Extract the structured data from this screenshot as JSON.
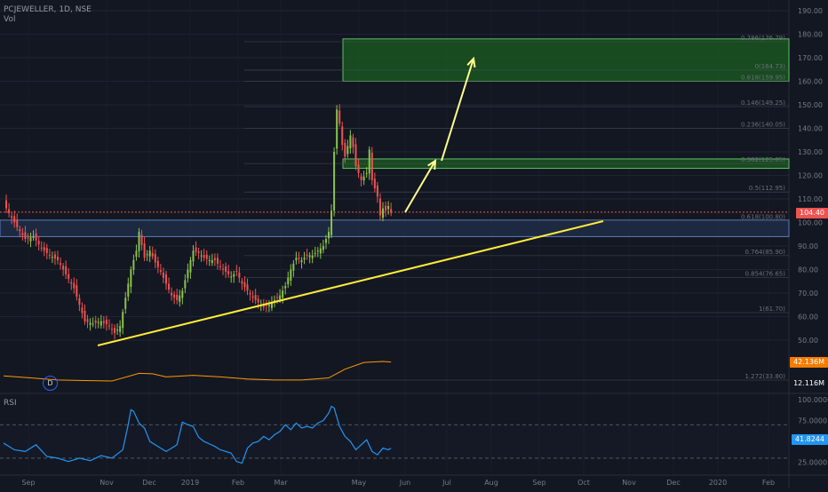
{
  "header": {
    "symbol": "PCJEWELLER, 1D, NSE",
    "vol_label": "Vol",
    "rsi_label": "RSI"
  },
  "colors": {
    "background": "#131722",
    "up": "#26a69a",
    "up_body": "#8bc34a",
    "down": "#ef5350",
    "trendline": "#ffeb3b",
    "arrow": "#ffff8d",
    "rsi": "#2196f3",
    "volume_ma": "#ff9800",
    "zone_green": "#1b5e20",
    "zone_blue": "#1e2b45",
    "price_line": "#ef5350"
  },
  "badges": {
    "price": "104.40",
    "volume_ma": "42.136M",
    "volume": "12.116M",
    "rsi": "41.8244"
  },
  "dividend_marker": "D",
  "chart_data": {
    "type": "candlestick",
    "title": "PCJEWELLER, 1D, NSE",
    "price_axis": {
      "ylim": [
        50,
        190
      ],
      "ticks": [
        "190.00",
        "180.00",
        "170.00",
        "160.00",
        "150.00",
        "140.00",
        "130.00",
        "120.00",
        "110.00",
        "100.00",
        "90.00",
        "80.00",
        "70.00",
        "60.00",
        "50.00"
      ]
    },
    "x_axis": {
      "labels": [
        "Sep",
        "Nov",
        "Dec",
        "2019",
        "Feb",
        "Mar",
        "May",
        "Jun",
        "Jul",
        "Aug",
        "Sep",
        "Oct",
        "Nov",
        "Dec",
        "2020",
        "Feb"
      ]
    },
    "fib_levels": [
      {
        "label": "0.786(176.79)",
        "value": 176.79
      },
      {
        "label": "0(164.73)",
        "value": 164.73
      },
      {
        "label": "0.618(159.95)",
        "value": 159.95
      },
      {
        "label": "0.146(149.25)",
        "value": 149.25
      },
      {
        "label": "0.236(140.05)",
        "value": 140.05
      },
      {
        "label": "0.382(125.05)",
        "value": 125.05
      },
      {
        "label": "0.5(112.95)",
        "value": 112.95
      },
      {
        "label": "0.618(100.80)",
        "value": 100.8
      },
      {
        "label": "0.764(85.90)",
        "value": 85.9
      },
      {
        "label": "0.854(76.65)",
        "value": 76.65
      },
      {
        "label": "1(61.70)",
        "value": 61.7
      },
      {
        "label": "1.272(33.80)",
        "value": 33.8
      }
    ],
    "zones": [
      {
        "kind": "green",
        "top": 178,
        "bottom": 160
      },
      {
        "kind": "green",
        "top": 127,
        "bottom": 123
      },
      {
        "kind": "blue",
        "top": 101,
        "bottom": 94
      }
    ],
    "last_price": 104.4,
    "price_path": [
      [
        0,
        108
      ],
      [
        2,
        104
      ],
      [
        5,
        98
      ],
      [
        8,
        93
      ],
      [
        11,
        94
      ],
      [
        14,
        89
      ],
      [
        17,
        86
      ],
      [
        20,
        84
      ],
      [
        23,
        78
      ],
      [
        26,
        72
      ],
      [
        28,
        65
      ],
      [
        30,
        58
      ],
      [
        33,
        57
      ],
      [
        36,
        58
      ],
      [
        39,
        56
      ],
      [
        41,
        53
      ],
      [
        43,
        56
      ],
      [
        45,
        68
      ],
      [
        47,
        80
      ],
      [
        49,
        88
      ],
      [
        50,
        96
      ],
      [
        52,
        85
      ],
      [
        54,
        88
      ],
      [
        56,
        83
      ],
      [
        58,
        79
      ],
      [
        60,
        74
      ],
      [
        62,
        69
      ],
      [
        64,
        67
      ],
      [
        66,
        71
      ],
      [
        68,
        80
      ],
      [
        70,
        88
      ],
      [
        72,
        87
      ],
      [
        74,
        85
      ],
      [
        76,
        84
      ],
      [
        78,
        84
      ],
      [
        80,
        81
      ],
      [
        82,
        79
      ],
      [
        84,
        77
      ],
      [
        86,
        79
      ],
      [
        88,
        74
      ],
      [
        90,
        71
      ],
      [
        92,
        68
      ],
      [
        94,
        66
      ],
      [
        96,
        64
      ],
      [
        98,
        65
      ],
      [
        100,
        67
      ],
      [
        102,
        69
      ],
      [
        104,
        73
      ],
      [
        106,
        80
      ],
      [
        108,
        85
      ],
      [
        110,
        84
      ],
      [
        112,
        86
      ],
      [
        114,
        86
      ],
      [
        116,
        88
      ],
      [
        118,
        90
      ],
      [
        120,
        96
      ],
      [
        121,
        105
      ],
      [
        122,
        130
      ],
      [
        123,
        148
      ],
      [
        124,
        142
      ],
      [
        125,
        133
      ],
      [
        126,
        128
      ],
      [
        128,
        137
      ],
      [
        129,
        132
      ],
      [
        130,
        124
      ],
      [
        132,
        118
      ],
      [
        134,
        121
      ],
      [
        135,
        131
      ],
      [
        136,
        118
      ],
      [
        138,
        111
      ],
      [
        139,
        103
      ],
      [
        140,
        106
      ],
      [
        141,
        105
      ],
      [
        142,
        107
      ],
      [
        143,
        104
      ]
    ],
    "volume_ma_path": [
      [
        0,
        22
      ],
      [
        10,
        18
      ],
      [
        20,
        14
      ],
      [
        30,
        13
      ],
      [
        40,
        12
      ],
      [
        50,
        27
      ],
      [
        55,
        26
      ],
      [
        60,
        20
      ],
      [
        70,
        23
      ],
      [
        80,
        20
      ],
      [
        90,
        16
      ],
      [
        100,
        14
      ],
      [
        110,
        14
      ],
      [
        120,
        18
      ],
      [
        126,
        35
      ],
      [
        133,
        48
      ],
      [
        140,
        50
      ],
      [
        143,
        49
      ]
    ],
    "rsi": {
      "name": "RSI",
      "ylim": [
        15,
        100
      ],
      "levels": [
        70,
        30
      ],
      "tick_labels": [
        "100.0000",
        "75.0000",
        "50.0000",
        "25.0000"
      ],
      "path": [
        [
          0,
          48
        ],
        [
          4,
          40
        ],
        [
          8,
          38
        ],
        [
          12,
          46
        ],
        [
          16,
          32
        ],
        [
          20,
          30
        ],
        [
          24,
          26
        ],
        [
          28,
          30
        ],
        [
          32,
          27
        ],
        [
          36,
          33
        ],
        [
          40,
          30
        ],
        [
          44,
          40
        ],
        [
          46,
          70
        ],
        [
          47,
          88
        ],
        [
          48,
          86
        ],
        [
          50,
          72
        ],
        [
          52,
          66
        ],
        [
          54,
          50
        ],
        [
          56,
          46
        ],
        [
          58,
          42
        ],
        [
          60,
          38
        ],
        [
          62,
          42
        ],
        [
          64,
          46
        ],
        [
          66,
          73
        ],
        [
          68,
          70
        ],
        [
          70,
          68
        ],
        [
          72,
          55
        ],
        [
          74,
          50
        ],
        [
          76,
          47
        ],
        [
          78,
          44
        ],
        [
          80,
          40
        ],
        [
          82,
          38
        ],
        [
          84,
          36
        ],
        [
          86,
          26
        ],
        [
          88,
          24
        ],
        [
          90,
          42
        ],
        [
          92,
          48
        ],
        [
          94,
          50
        ],
        [
          96,
          56
        ],
        [
          98,
          52
        ],
        [
          100,
          58
        ],
        [
          102,
          62
        ],
        [
          104,
          70
        ],
        [
          106,
          64
        ],
        [
          108,
          72
        ],
        [
          110,
          66
        ],
        [
          112,
          68
        ],
        [
          114,
          66
        ],
        [
          116,
          72
        ],
        [
          118,
          75
        ],
        [
          120,
          84
        ],
        [
          121,
          92
        ],
        [
          122,
          90
        ],
        [
          124,
          68
        ],
        [
          126,
          56
        ],
        [
          128,
          50
        ],
        [
          130,
          40
        ],
        [
          132,
          46
        ],
        [
          134,
          52
        ],
        [
          136,
          38
        ],
        [
          138,
          34
        ],
        [
          140,
          42
        ],
        [
          142,
          40
        ],
        [
          143,
          42
        ]
      ]
    }
  }
}
